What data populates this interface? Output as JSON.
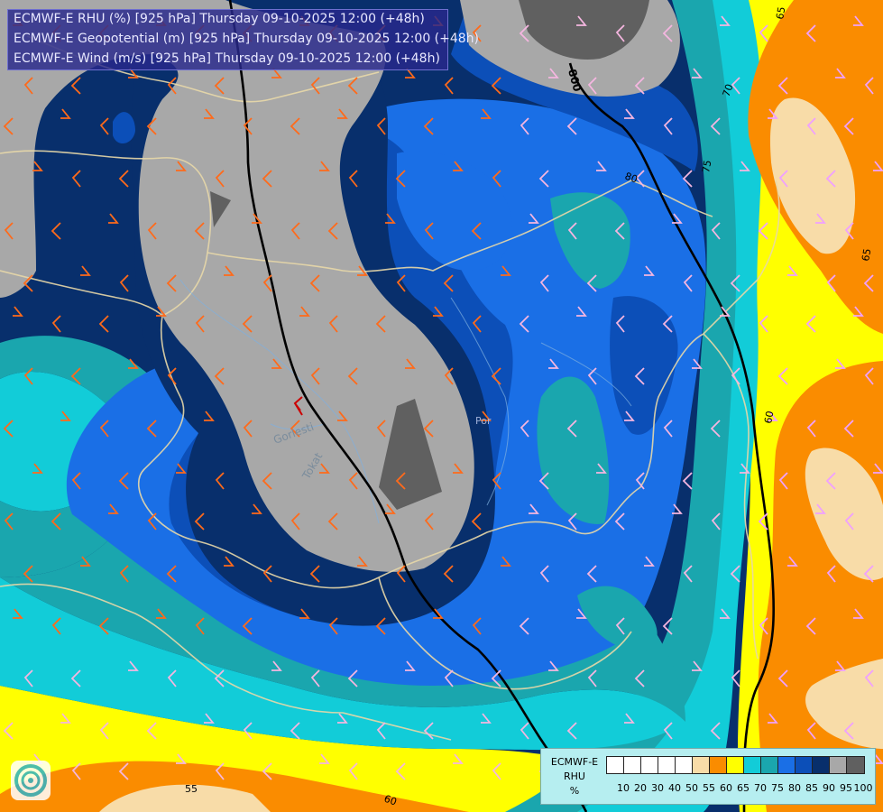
{
  "header": {
    "lines": [
      "ECMWF-E RHU (%) [925 hPa] Thursday 09-10-2025 12:00 (+48h)",
      "ECMWF-E Geopotential (m) [925 hPa] Thursday 09-10-2025 12:00 (+48h)",
      "ECMWF-E Wind (m/s) [925 hPa] Thursday 09-10-2025 12:00 (+48h)"
    ]
  },
  "map": {
    "place_labels": [
      "Gorlesti",
      "Tokat"
    ],
    "point_label": "Por",
    "geopotential_contours": [
      "60",
      "65",
      "70",
      "75",
      "80",
      "55",
      "65",
      "60",
      "800"
    ],
    "colors": {
      "c10": "#ffffff",
      "c55": "#f8dca8",
      "c60": "#fa8c00",
      "c65": "#ffff00",
      "c70": "#12ccd8",
      "c75": "#1aa6ae",
      "c80": "#1a6fe6",
      "c85": "#0c4fb8",
      "c90": "#082f6c",
      "c95": "#a8a8a8",
      "c100": "#606060"
    }
  },
  "legend": {
    "title_lines": [
      "ECMWF-E",
      "RHU",
      "%"
    ],
    "ticks": [
      "10",
      "20",
      "30",
      "40",
      "50",
      "55",
      "60",
      "65",
      "70",
      "75",
      "80",
      "85",
      "90",
      "95",
      "100"
    ],
    "swatch_colors": [
      "#ffffff",
      "#ffffff",
      "#ffffff",
      "#ffffff",
      "#ffffff",
      "#f8dca8",
      "#fa8c00",
      "#ffff00",
      "#12ccd8",
      "#1aa6ae",
      "#1a6fe6",
      "#0c4fb8",
      "#082f6c",
      "#a8a8a8",
      "#606060"
    ]
  },
  "logo": {
    "icon": "ecmwf-swirl-icon"
  }
}
